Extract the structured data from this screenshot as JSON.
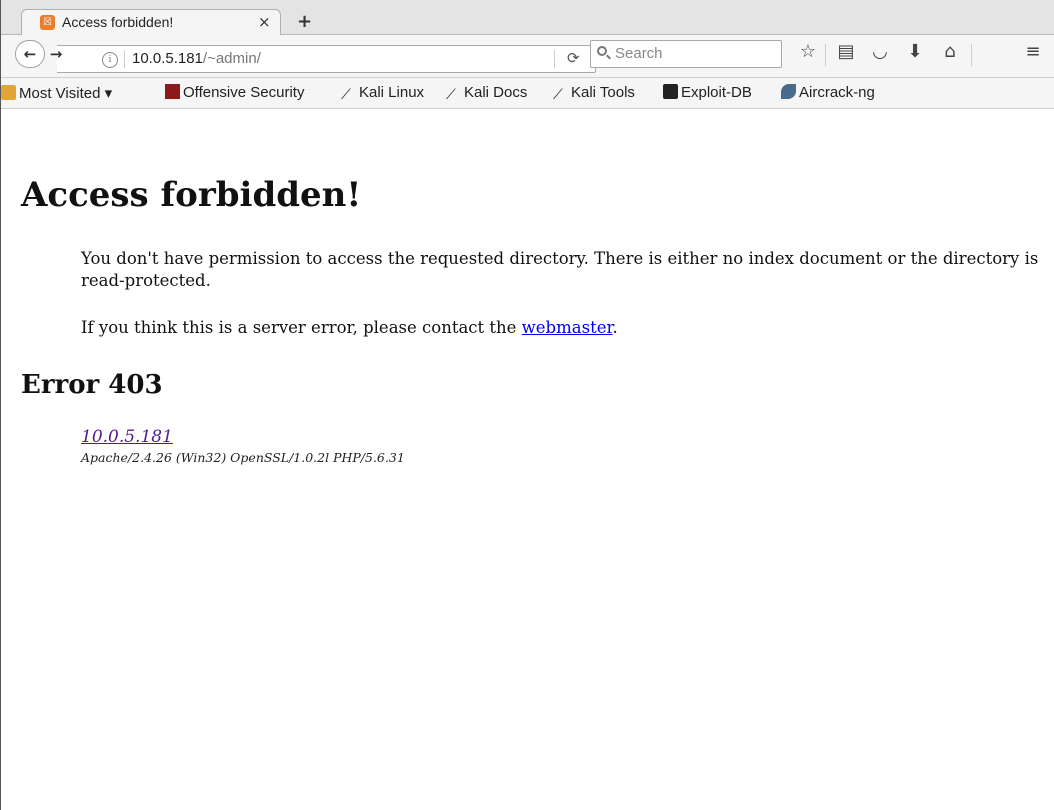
{
  "tab": {
    "title": "Access forbidden!",
    "close": "×",
    "new_tab": "+"
  },
  "nav": {
    "url_host": "10.0.5.181",
    "url_path": "/~admin/",
    "search_placeholder": "Search"
  },
  "bookmarks": [
    {
      "label": "Most Visited ▾",
      "icon": "folder-icon"
    },
    {
      "label": "Offensive Security",
      "icon": "offsec-icon"
    },
    {
      "label": "Kali Linux",
      "icon": "kali-dragon-icon"
    },
    {
      "label": "Kali Docs",
      "icon": "kali-dragon-icon"
    },
    {
      "label": "Kali Tools",
      "icon": "kali-dragon-icon"
    },
    {
      "label": "Exploit-DB",
      "icon": "exploitdb-icon"
    },
    {
      "label": "Aircrack-ng",
      "icon": "aircrack-icon"
    }
  ],
  "page": {
    "heading": "Access forbidden!",
    "message": "You don't have permission to access the requested directory. There is either no index document or the directory is read-protected.",
    "contact_prefix": "If you think this is a server error, please contact the ",
    "contact_link": "webmaster",
    "contact_suffix": ".",
    "error_heading": "Error 403",
    "address_link": "10.0.5.181",
    "server_signature": "Apache/2.4.26 (Win32) OpenSSL/1.0.2l PHP/5.6.31"
  },
  "colors": {
    "link": "#0000ee",
    "visited_link": "#551a8b",
    "favicon": "#e97d2d"
  }
}
